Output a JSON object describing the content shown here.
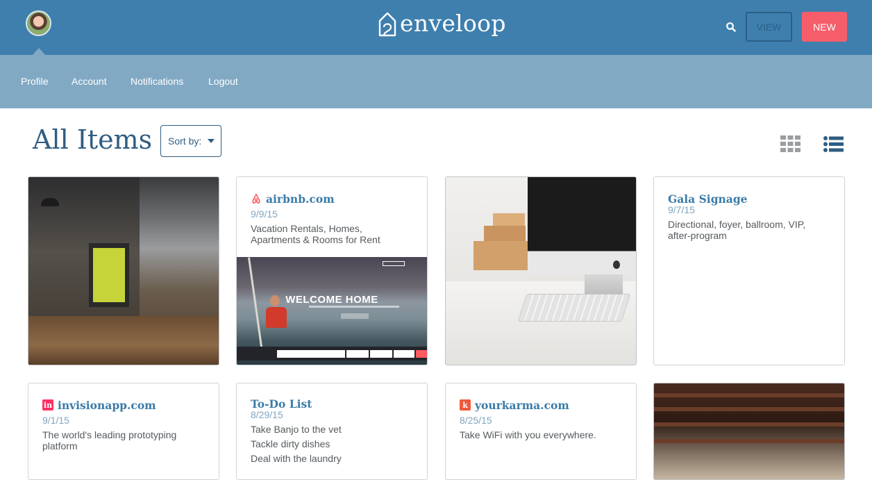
{
  "header": {
    "brand_name": "enveloop",
    "view_button": "VIEW",
    "new_button": "NEW",
    "colors": {
      "bar": "#3e7fae",
      "new_button": "#f65d6a"
    }
  },
  "subnav": {
    "items": [
      {
        "label": "Profile"
      },
      {
        "label": "Account"
      },
      {
        "label": "Notifications"
      },
      {
        "label": "Logout"
      }
    ]
  },
  "page": {
    "title": "All Items",
    "sort_label": "Sort by:"
  },
  "cards": {
    "airbnb": {
      "title": "airbnb.com",
      "date": "9/9/15",
      "description": "Vacation Rentals, Homes, Apartments & Rooms for Rent",
      "screenshot_headline": "WELCOME HOME"
    },
    "gala": {
      "title": "Gala Signage",
      "date": "9/7/15",
      "description": "Directional, foyer, ballroom, VIP, after-program"
    },
    "invision": {
      "title": "invisionapp.com",
      "icon_letter": "in",
      "date": "9/1/15",
      "description": "The world's leading prototyping platform"
    },
    "todo": {
      "title": "To-Do List",
      "date": "8/29/15",
      "items": [
        "Take Banjo to the vet",
        "Tackle dirty dishes",
        "Deal with the laundry"
      ]
    },
    "yourkarma": {
      "title": "yourkarma.com",
      "icon_letter": "k",
      "date": "8/25/15",
      "description": "Take WiFi with you everywhere."
    }
  }
}
